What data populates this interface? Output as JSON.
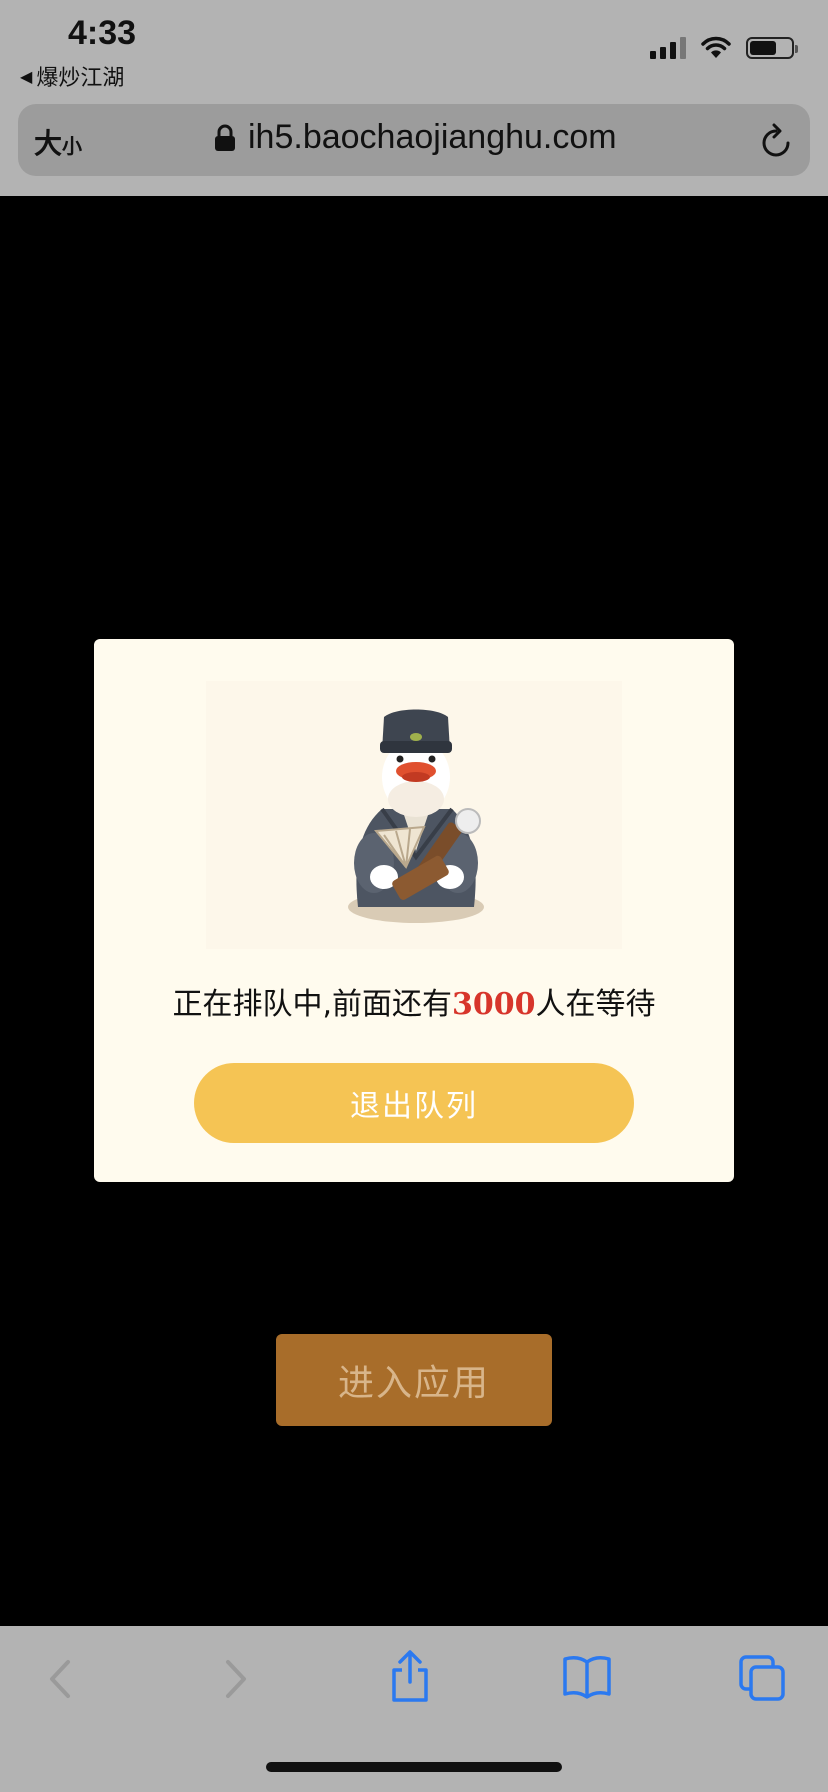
{
  "status_bar": {
    "time": "4:33",
    "back_app_label": "爆炒江湖"
  },
  "url_bar": {
    "text_size_label": "大",
    "text_size_small": "小",
    "url": "ih5.baochaojianghu.com"
  },
  "modal": {
    "queue_prefix": "正在排队中,前面还有",
    "queue_count": "3000",
    "queue_suffix": "人在等待",
    "exit_button_label": "退出队列",
    "mascot_icon": "duck-scholar-mascot"
  },
  "enter_button_label": "进入应用",
  "toolbar": {
    "items": [
      "back-icon",
      "forward-icon",
      "share-icon",
      "bookmarks-icon",
      "tabs-icon"
    ]
  },
  "colors": {
    "accent_yellow": "#f5c454",
    "count_red": "#d7352b",
    "enter_button": "#a86d2a",
    "ios_blue": "#2b79f0"
  }
}
